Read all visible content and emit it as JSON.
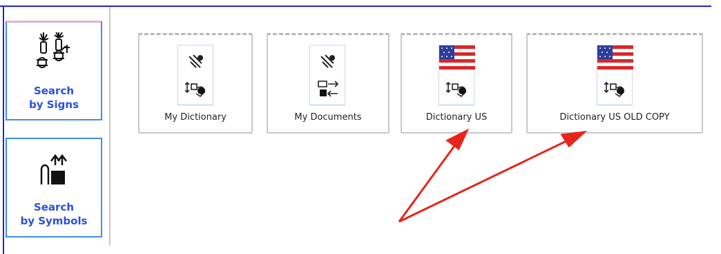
{
  "sidebar": {
    "items": [
      {
        "label": "Search\nby Signs",
        "icon": "hands-signs-icon"
      },
      {
        "label": "Search\nby Symbols",
        "icon": "symbols-icon"
      }
    ]
  },
  "dictionaries": [
    {
      "label": "My Dictionary",
      "icon": "signwriting-icon"
    },
    {
      "label": "My Documents",
      "icon": "signwriting-icon"
    },
    {
      "label": "Dictionary US",
      "icon": "us-flag-icon"
    },
    {
      "label": "Dictionary US OLD COPY",
      "icon": "us-flag-icon"
    }
  ],
  "colors": {
    "frame": "#2323d6",
    "sidebar_label": "#2a4fe0",
    "button_border": "#3b8df0",
    "annotation_arrow": "#e8241b",
    "flag_red": "#d92828",
    "flag_blue": "#2c3e9a"
  }
}
